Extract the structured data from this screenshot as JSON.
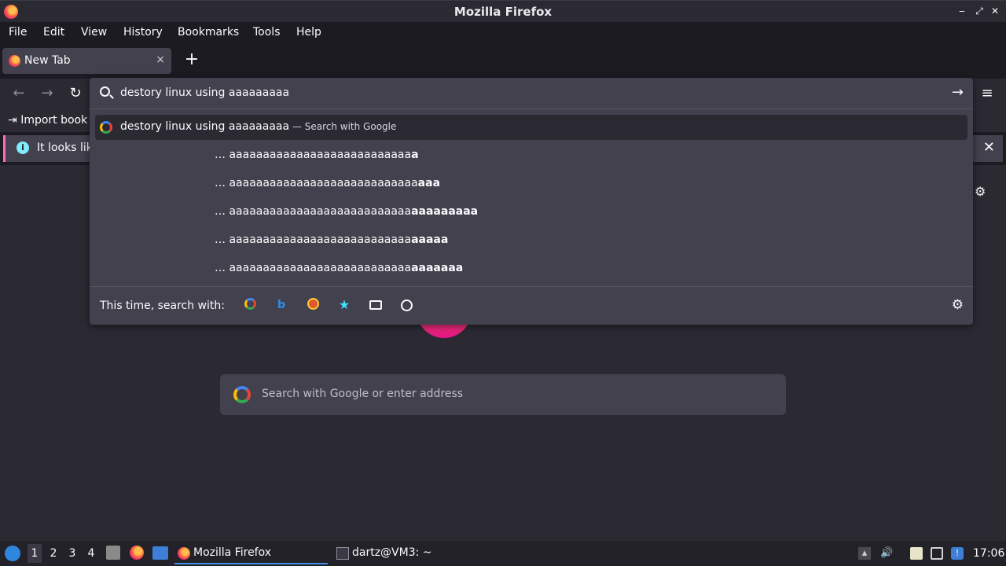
{
  "window": {
    "title": "Mozilla Firefox"
  },
  "menu": [
    "File",
    "Edit",
    "View",
    "History",
    "Bookmarks",
    "Tools",
    "Help"
  ],
  "tab": {
    "label": "New Tab",
    "close": "×",
    "new_tab": "+"
  },
  "nav": {
    "back": "←",
    "forward": "→",
    "reload": "↻",
    "menu": "≡"
  },
  "bookmarks": {
    "import_label": "Import book"
  },
  "infobar": {
    "text": "It looks lik",
    "icon": "i",
    "close": "✕"
  },
  "urlbar": {
    "value": "destory linux using aaaaaaaaa",
    "go": "→",
    "suggestions": [
      {
        "text": "destory linux using aaaaaaaaa",
        "sep": " — ",
        "sub": "Search with Google"
      },
      {
        "prefix": "… aaaaaaaaaaaaaaaaaaaaaaaaaaa",
        "bold": "a"
      },
      {
        "prefix": "… aaaaaaaaaaaaaaaaaaaaaaaaaaaa",
        "bold": "aaa"
      },
      {
        "prefix": "… aaaaaaaaaaaaaaaaaaaaaaaaaaa",
        "bold": "aaaaaaaaa"
      },
      {
        "prefix": "… aaaaaaaaaaaaaaaaaaaaaaaaaaa",
        "bold": "aaaaa"
      },
      {
        "prefix": "… aaaaaaaaaaaaaaaaaaaaaaaaaaa",
        "bold": "aaaaaaa"
      }
    ],
    "oneoff_label": "This time, search with:",
    "engines": [
      "google-icon",
      "bing-icon",
      "duckduckgo-icon",
      "bookmarks-star-icon",
      "tabs-icon",
      "history-clock-icon"
    ],
    "settings": "⚙"
  },
  "newtab_page": {
    "search_placeholder": "Search with Google or enter address",
    "settings": "⚙"
  },
  "taskbar": {
    "workspaces": [
      "1",
      "2",
      "3",
      "4"
    ],
    "apps": [
      {
        "label": "Mozilla Firefox"
      },
      {
        "label": "dartz@VM3: ~"
      }
    ],
    "clock": "17:06"
  },
  "colors": {
    "accent": "#3d8ee9",
    "infobar_stripe": "#ff6bba",
    "panel": "#42414d"
  }
}
